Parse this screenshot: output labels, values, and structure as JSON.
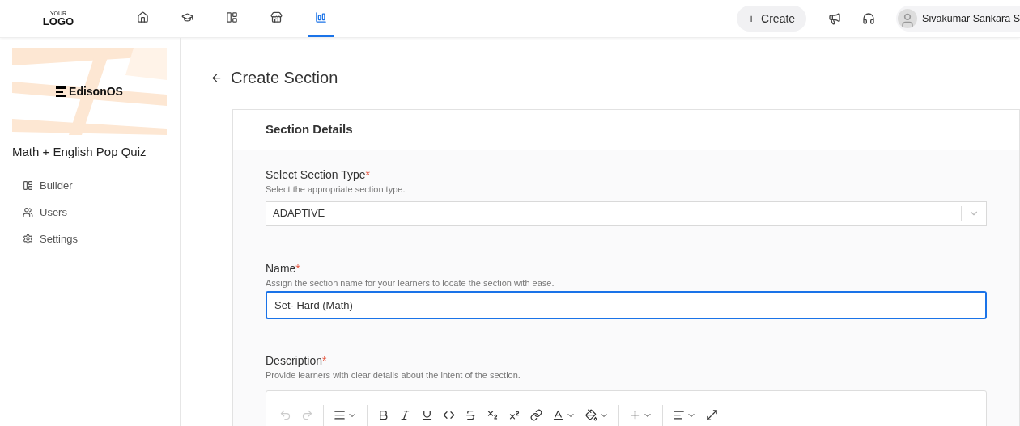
{
  "header": {
    "logo": {
      "top": "YOUR",
      "main": "LOGO"
    },
    "nav": [
      {
        "kind": "home",
        "selected": false
      },
      {
        "kind": "learn",
        "selected": false
      },
      {
        "kind": "layout",
        "selected": false
      },
      {
        "kind": "store",
        "selected": false
      },
      {
        "kind": "reports",
        "selected": true
      }
    ],
    "create_button": {
      "icon": "+",
      "label": "Create"
    },
    "user": {
      "name": "Sivakumar Sankara S"
    }
  },
  "sidebar": {
    "banner_title": "EdisonOS",
    "quiz_title": "Math + English Pop Quiz",
    "items": [
      {
        "kind": "builder",
        "label": "Builder"
      },
      {
        "kind": "users",
        "label": "Users"
      },
      {
        "kind": "settings",
        "label": "Settings"
      }
    ]
  },
  "page": {
    "title": "Create Section",
    "card_title": "Section Details",
    "fields": [
      {
        "kind": "select",
        "label": "Select Section Type",
        "required_mark": "*",
        "hint": "Select the appropriate section type.",
        "value": "ADAPTIVE",
        "focused": false
      },
      {
        "kind": "text",
        "label": "Name",
        "required_mark": "*",
        "hint": "Assign the section name for your learners to locate the section with ease.",
        "value": "Set- Hard (Math)",
        "focused": true
      },
      {
        "kind": "editor",
        "label": "Description",
        "required_mark": "*",
        "hint": "Provide learners with clear details about the intent of the section.",
        "toolbar": [
          {
            "kind": "undo",
            "disabled": true,
            "dropdown": false
          },
          {
            "kind": "redo",
            "disabled": true,
            "dropdown": false
          },
          {
            "kind": "sep"
          },
          {
            "kind": "paragraph",
            "disabled": false,
            "dropdown": true
          },
          {
            "kind": "sep"
          },
          {
            "kind": "bold",
            "disabled": false,
            "dropdown": false
          },
          {
            "kind": "italic",
            "disabled": false,
            "dropdown": false
          },
          {
            "kind": "underline",
            "disabled": false,
            "dropdown": false
          },
          {
            "kind": "code",
            "disabled": false,
            "dropdown": false
          },
          {
            "kind": "strike",
            "disabled": false,
            "dropdown": false
          },
          {
            "kind": "subscript",
            "disabled": false,
            "dropdown": false
          },
          {
            "kind": "superscript",
            "disabled": false,
            "dropdown": false
          },
          {
            "kind": "link",
            "disabled": false,
            "dropdown": false
          },
          {
            "kind": "text-color",
            "disabled": false,
            "dropdown": true
          },
          {
            "kind": "highlight",
            "disabled": false,
            "dropdown": true
          },
          {
            "kind": "sep"
          },
          {
            "kind": "insert",
            "disabled": false,
            "dropdown": true
          },
          {
            "kind": "sep"
          },
          {
            "kind": "align",
            "disabled": false,
            "dropdown": true
          },
          {
            "kind": "expand",
            "disabled": false,
            "dropdown": false
          }
        ]
      }
    ]
  }
}
